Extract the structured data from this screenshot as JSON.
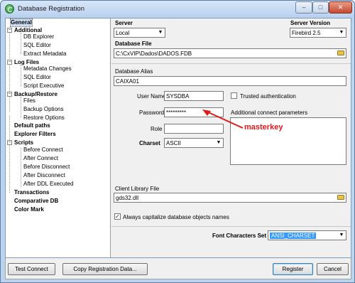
{
  "window": {
    "title": "Database Registration",
    "controls": {
      "minimize": "–",
      "maximize": "□",
      "close": "✕"
    }
  },
  "sidebar": {
    "items": [
      {
        "label": "General",
        "level": 0,
        "selected": true
      },
      {
        "label": "Additional",
        "level": 0,
        "expander": "−"
      },
      {
        "label": "DB Explorer",
        "level": 1
      },
      {
        "label": "SQL Editor",
        "level": 1
      },
      {
        "label": "Extract Metadata",
        "level": 1
      },
      {
        "label": "Log Files",
        "level": 0,
        "expander": "−"
      },
      {
        "label": "Metadata Changes",
        "level": 1
      },
      {
        "label": "SQL Editor",
        "level": 1
      },
      {
        "label": "Script Executive",
        "level": 1
      },
      {
        "label": "Backup/Restore",
        "level": 0,
        "expander": "−"
      },
      {
        "label": "Files",
        "level": 1
      },
      {
        "label": "Backup Options",
        "level": 1
      },
      {
        "label": "Restore Options",
        "level": 1
      },
      {
        "label": "Default paths",
        "level": 0
      },
      {
        "label": "Explorer Filters",
        "level": 0
      },
      {
        "label": "Scripts",
        "level": 0,
        "expander": "−"
      },
      {
        "label": "Before Connect",
        "level": 1
      },
      {
        "label": "After Connect",
        "level": 1
      },
      {
        "label": "Before Disconnect",
        "level": 1
      },
      {
        "label": "After Disconnect",
        "level": 1
      },
      {
        "label": "After DDL Executed",
        "level": 1
      },
      {
        "label": "Transactions",
        "level": 0
      },
      {
        "label": "Comparative DB",
        "level": 0
      },
      {
        "label": "Color Mark",
        "level": 0
      }
    ]
  },
  "form": {
    "server_label": "Server",
    "server_value": "Local",
    "server_version_label": "Server Version",
    "server_version_value": "Firebird 2.5",
    "database_file_label": "Database File",
    "database_file_value": "C:\\CxVIP\\Dados\\DADOS.FDB",
    "database_alias_label": "Database Alias",
    "database_alias_value": "CAIXA01",
    "user_name_label": "User Name",
    "user_name_value": "SYSDBA",
    "trusted_auth_label": "Trusted authentication",
    "password_label": "Password",
    "password_value": "*********",
    "additional_params_label": "Additional connect parameters",
    "role_label": "Role",
    "role_value": "",
    "charset_label": "Charset",
    "charset_value": "ASCII",
    "annotation": "masterkey",
    "client_library_label": "Client Library File",
    "client_library_value": "gds32.dll",
    "capitalize_label": "Always capitalize database objects names",
    "capitalize_checked": true,
    "font_charset_label": "Font Characters Set",
    "font_charset_value": "ANSI_CHARSET"
  },
  "footer": {
    "test_connect": "Test Connect",
    "copy_registration": "Copy Registration Data...",
    "register": "Register",
    "cancel": "Cancel"
  },
  "colors": {
    "annotation": "#e01919",
    "selection": "#3399ff"
  }
}
